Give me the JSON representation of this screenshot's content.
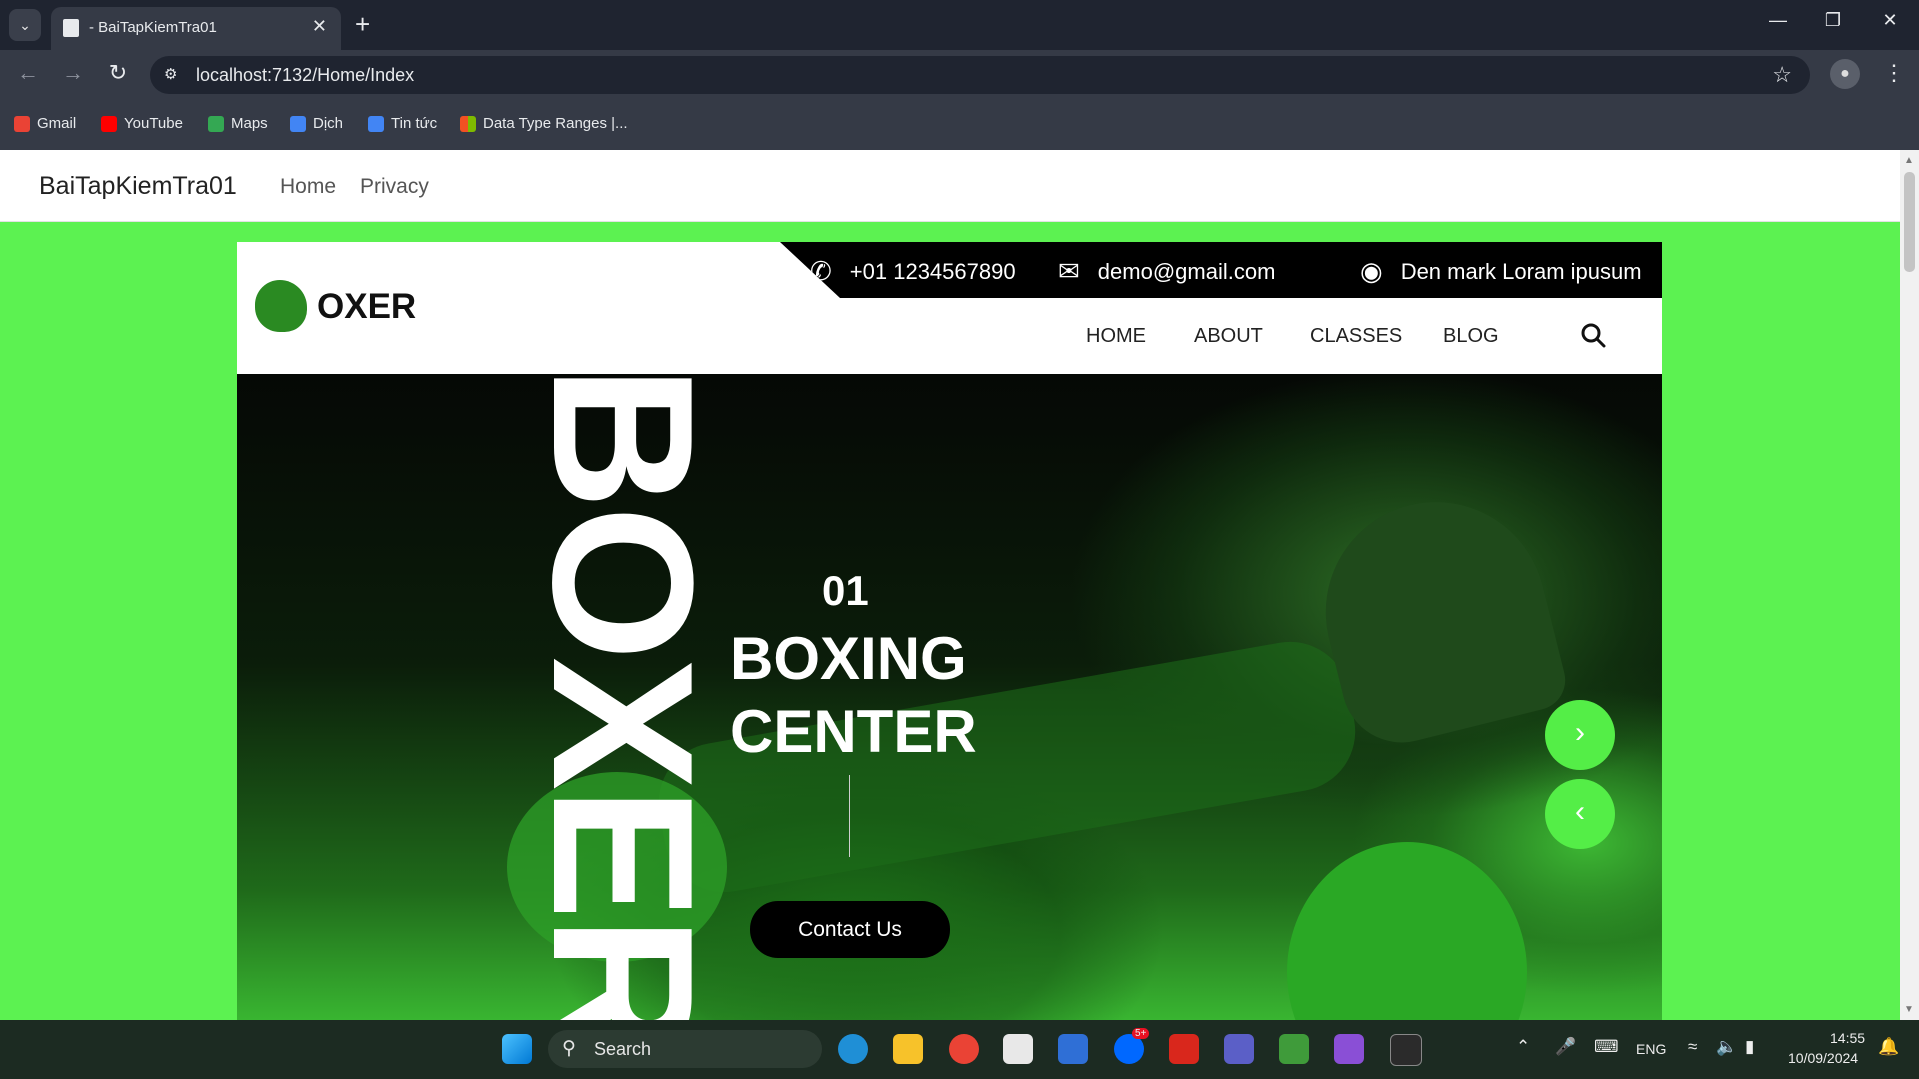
{
  "browser": {
    "tab_title": "- BaiTapKiemTra01",
    "url": "localhost:7132/Home/Index",
    "bookmarks": [
      {
        "label": "Gmail",
        "color": "#ea4335"
      },
      {
        "label": "YouTube",
        "color": "#ff0000"
      },
      {
        "label": "Maps",
        "color": "#34a853"
      },
      {
        "label": "Dịch",
        "color": "#4285f4"
      },
      {
        "label": "Tin tức",
        "color": "#4285f4"
      },
      {
        "label": "Data Type Ranges |...",
        "color": "#f25022"
      }
    ]
  },
  "app": {
    "brand": "BaiTapKiemTra01",
    "nav": [
      "Home",
      "Privacy"
    ]
  },
  "site": {
    "logo": "OXER",
    "contact": {
      "phone": "+01 1234567890",
      "email": "demo@gmail.com",
      "address": "Den mark Loram ipusum"
    },
    "nav": [
      "HOME",
      "ABOUT",
      "CLASSES",
      "BLOG"
    ],
    "hero": {
      "vertical_word": "BOXER",
      "slide_number": "01",
      "title_line1": "BOXING",
      "title_line2": "CENTER",
      "button": "Contact Us"
    },
    "accent_color": "#5cf251"
  },
  "taskbar": {
    "search_label": "Search",
    "language": "ENG",
    "time": "14:55",
    "date": "10/09/2024",
    "zalo_badge": "5+"
  }
}
